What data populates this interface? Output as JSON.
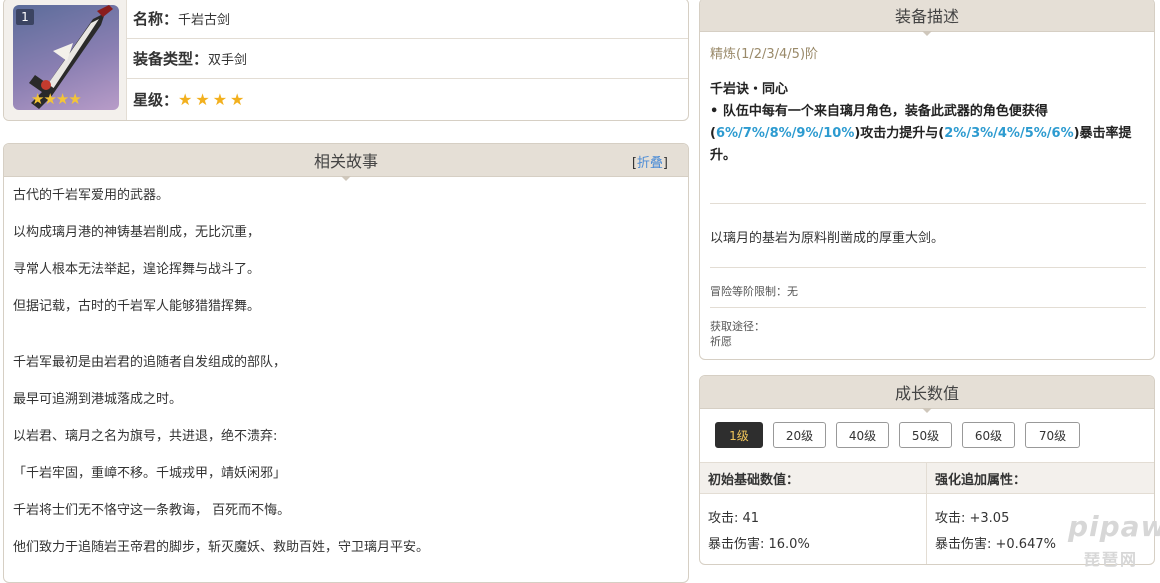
{
  "weapon": {
    "rank": "1",
    "name_label": "名称：",
    "name_value": "千岩古剑",
    "type_label": "装备类型：",
    "type_value": "双手剑",
    "star_label": "星级：",
    "stars": 4
  },
  "story": {
    "title": "相关故事",
    "fold_open": "[",
    "fold_label": "折叠",
    "fold_close": "]",
    "lines": [
      "古代的千岩军爱用的武器。",
      "以构成璃月港的神铸基岩削成，无比沉重，",
      "寻常人根本无法举起，遑论挥舞与战斗了。",
      "但据记载，古时的千岩军人能够猎猎挥舞。",
      "",
      "千岩军最初是由岩君的追随者自发组成的部队，",
      "最早可追溯到港城落成之时。",
      "以岩君、璃月之名为旗号，共进退，绝不溃弃:",
      "「千岩牢固，重嶂不移。千城戎甲，靖妖闲邪」",
      "千岩将士们无不恪守这一条教诲， 百死而不悔。",
      "他们致力于追随岩王帝君的脚步，斩灭魔妖、救助百姓，守卫璃月平安。"
    ]
  },
  "equip": {
    "title": "装备描述",
    "refine": "精炼(1/2/3/4/5)阶",
    "passive_name": "千岩诀・同心",
    "passive_p1": "• 队伍中每有一个来自璃月角色，装备此武器的角色便获得(",
    "passive_hl1": "6%/7%/8%/9%/10%",
    "passive_p2": ")攻击力提升与(",
    "passive_hl2": "2%/3%/4%/5%/6%",
    "passive_p3": ")暴击率提升。",
    "flavor": "以璃月的基岩为原料削凿成的厚重大剑。",
    "limit": "冒险等阶限制：无",
    "source_label": "获取途径：",
    "source_value": "祈愿"
  },
  "growth": {
    "title": "成长数值",
    "levels": [
      "1级",
      "20级",
      "40级",
      "50级",
      "60级",
      "70级"
    ],
    "active_level": "1级",
    "base_head": "初始基础数值：",
    "bonus_head": "强化追加属性：",
    "base_atk": "攻击: 41",
    "base_crit": "暴击伤害: 16.0%",
    "bonus_atk": "攻击: +3.05",
    "bonus_crit": "暴击伤害: +0.647%"
  },
  "watermark": {
    "top": "pipaw",
    "bottom": "琵琶网"
  },
  "colors": {
    "highlight": "#2d9bd0",
    "header_bg": "#e5dfd6",
    "star": "#f2b01e"
  }
}
